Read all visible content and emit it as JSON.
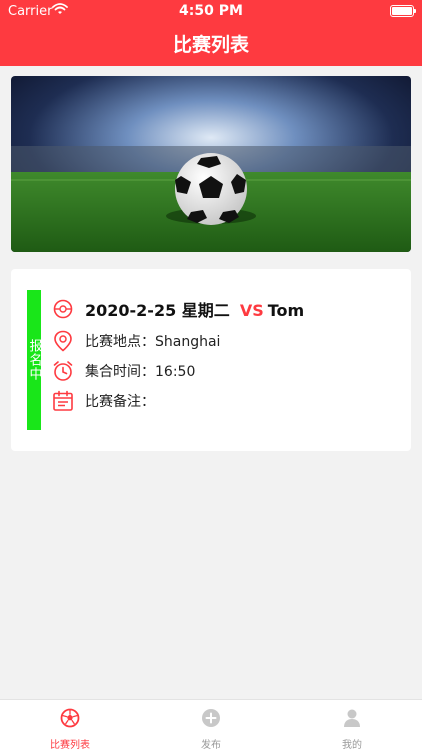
{
  "status_bar": {
    "carrier": "Carrier",
    "time": "4:50 PM"
  },
  "nav": {
    "title": "比赛列表"
  },
  "match": {
    "status": "报名中",
    "date": "2020-2-25",
    "weekday": "星期二",
    "vs": "VS",
    "opponent": "Tom",
    "location_label": "比赛地点：",
    "location": "Shanghai",
    "gather_label": "集合时间：",
    "gather_time": "16:50",
    "note_label": "比赛备注：",
    "note": ""
  },
  "tabs": [
    {
      "label": "比赛列表",
      "icon": "soccer-ball-icon",
      "active": true
    },
    {
      "label": "发布",
      "icon": "add-icon",
      "active": false
    },
    {
      "label": "我的",
      "icon": "user-icon",
      "active": false
    }
  ],
  "colors": {
    "accent": "#fe3a40",
    "status_green": "#19e619",
    "inactive": "#c8c8c8"
  }
}
